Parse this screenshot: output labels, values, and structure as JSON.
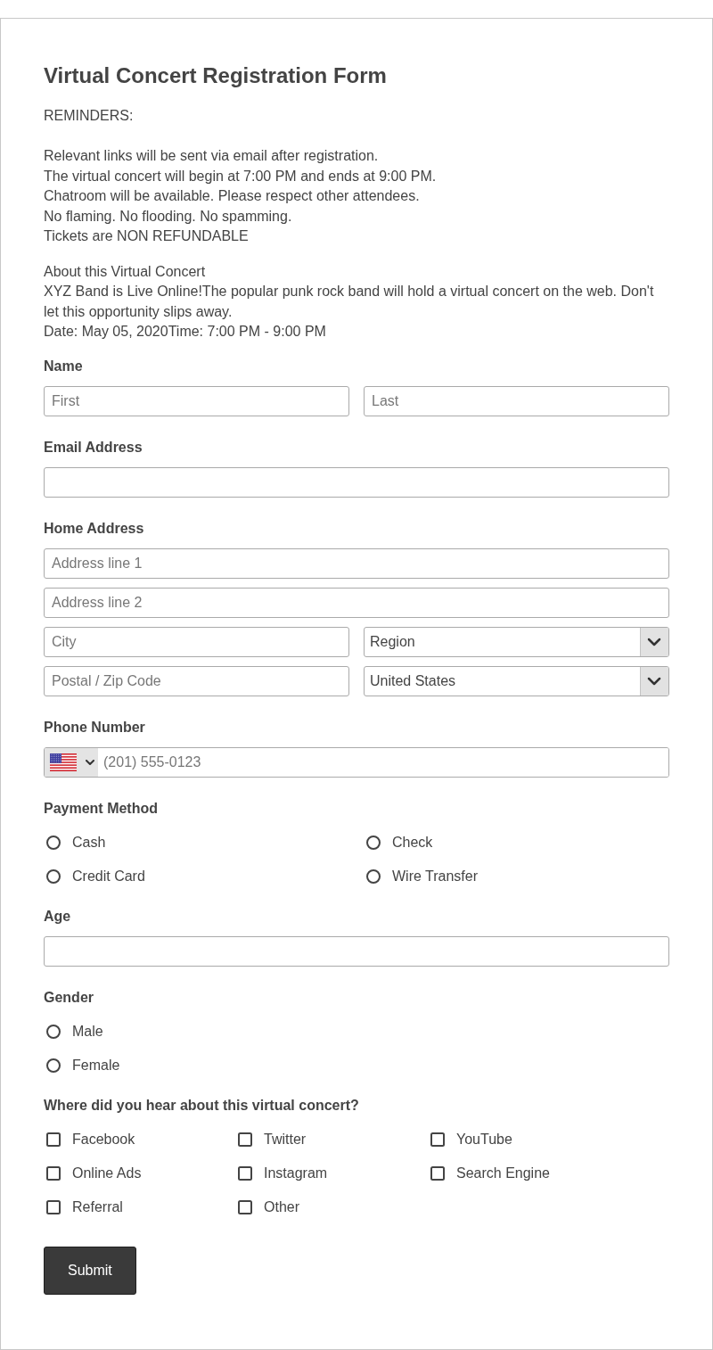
{
  "title": "Virtual Concert Registration Form",
  "reminders": {
    "heading": "REMINDERS:",
    "lines": [
      "Relevant links will be sent via email after registration.",
      "The virtual concert will begin at 7:00 PM and ends at 9:00 PM.",
      "Chatroom will be available. Please respect other attendees.",
      "No flaming. No flooding. No spamming.",
      "Tickets are NON REFUNDABLE"
    ]
  },
  "about": {
    "heading": "About this Virtual Concert",
    "lines": [
      "XYZ Band is Live Online!The popular punk rock band will hold a virtual concert on the web. Don't let this opportunity slips away.",
      "Date: May 05, 2020Time: 7:00 PM - 9:00 PM"
    ]
  },
  "sections": [
    {
      "kind": "inputs",
      "label": "Name",
      "rows": [
        [
          {
            "kind": "text",
            "placeholder": "First"
          },
          {
            "kind": "text",
            "placeholder": "Last"
          }
        ]
      ]
    },
    {
      "kind": "inputs",
      "label": "Email Address",
      "rows": [
        [
          {
            "kind": "text"
          }
        ]
      ]
    },
    {
      "kind": "inputs",
      "label": "Home Address",
      "rows": [
        [
          {
            "kind": "text",
            "placeholder": "Address line 1"
          }
        ],
        [
          {
            "kind": "text",
            "placeholder": "Address line 2"
          }
        ],
        [
          {
            "kind": "text",
            "placeholder": "City"
          },
          {
            "kind": "select",
            "value": "Region"
          }
        ],
        [
          {
            "kind": "text",
            "placeholder": "Postal / Zip Code"
          },
          {
            "kind": "select",
            "value": "United States"
          }
        ]
      ]
    },
    {
      "kind": "inputs",
      "label": "Phone Number",
      "rows": [
        [
          {
            "kind": "phone",
            "placeholder": "(201) 555-0123"
          }
        ]
      ]
    },
    {
      "kind": "radios",
      "label": "Payment Method",
      "rows": [
        [
          {
            "label": "Cash",
            "selected": false
          },
          {
            "label": "Check",
            "selected": false
          }
        ],
        [
          {
            "label": "Credit Card",
            "selected": false
          },
          {
            "label": "Wire Transfer",
            "selected": false
          }
        ]
      ]
    },
    {
      "kind": "inputs",
      "label": "Age",
      "rows": [
        [
          {
            "kind": "text"
          }
        ]
      ]
    },
    {
      "kind": "radios",
      "label": "Gender",
      "rows": [
        [
          {
            "label": "Male",
            "selected": false
          }
        ],
        [
          {
            "label": "Female",
            "selected": false
          }
        ]
      ]
    },
    {
      "kind": "checkboxes",
      "label": "Where did you hear about this virtual concert?",
      "rows": [
        [
          {
            "label": "Facebook",
            "checked": false
          },
          {
            "label": "Twitter",
            "checked": false
          },
          {
            "label": "YouTube",
            "checked": false
          }
        ],
        [
          {
            "label": "Online Ads",
            "checked": false
          },
          {
            "label": "Instagram",
            "checked": false
          },
          {
            "label": "Search Engine",
            "checked": false
          }
        ],
        [
          {
            "label": "Referral",
            "checked": false
          },
          {
            "label": "Other",
            "checked": false
          }
        ]
      ]
    }
  ],
  "submit": {
    "label": "Submit"
  }
}
